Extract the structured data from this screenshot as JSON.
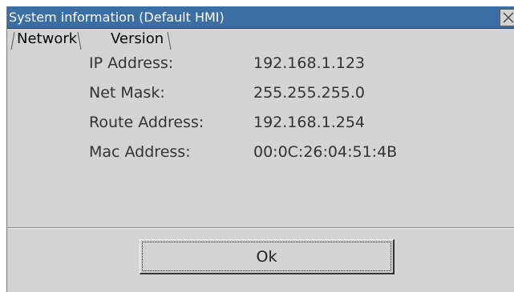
{
  "window": {
    "title": "System information (Default HMI)"
  },
  "tabs": [
    {
      "label": "Network",
      "active": true
    },
    {
      "label": "Version",
      "active": false
    }
  ],
  "network": {
    "fields": [
      {
        "label": "IP Address:",
        "value": "192.168.1.123"
      },
      {
        "label": "Net Mask:",
        "value": "255.255.255.0"
      },
      {
        "label": "Route Address:",
        "value": "192.168.1.254"
      },
      {
        "label": "Mac Address:",
        "value": "00:0C:26:04:51:4B"
      }
    ]
  },
  "buttons": {
    "ok_label": "Ok"
  },
  "icons": {
    "close": "close-icon"
  },
  "colors": {
    "titlebar": "#3a6ea5",
    "window_bg": "#d4d4d4",
    "title_text": "#ffffff",
    "field_text": "#333333"
  }
}
